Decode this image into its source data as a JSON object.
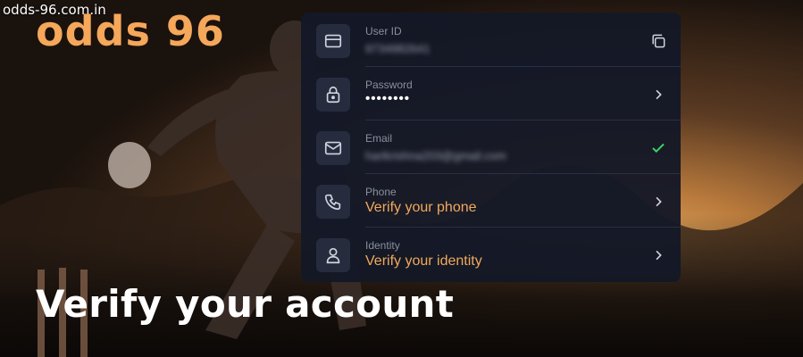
{
  "site_url": "odds-96.com.in",
  "brand": "odds 96",
  "headline": "Verify your account",
  "account_rows": [
    {
      "label": "User ID",
      "value": "9734982641",
      "trailing_icon": "copy-icon"
    },
    {
      "label": "Password",
      "value": "••••••••",
      "trailing_icon": "chevron-right-icon"
    },
    {
      "label": "Email",
      "value": "harikrishna203@gmail.com",
      "trailing_icon": "check-icon"
    },
    {
      "label": "Phone",
      "value": "Verify your phone",
      "trailing_icon": "chevron-right-icon"
    },
    {
      "label": "Identity",
      "value": "Verify your identity",
      "trailing_icon": "chevron-right-icon"
    }
  ],
  "colors": {
    "brand": "#f5a75a",
    "accent_link": "#f0a95c",
    "verified": "#3ad16a",
    "panel_bg": "#141826",
    "icon_box_bg": "#262c3e"
  }
}
